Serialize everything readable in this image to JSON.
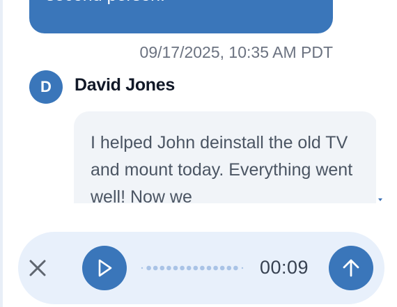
{
  "messages": {
    "outgoing": {
      "text": "second person."
    },
    "incoming": {
      "timestamp": "09/17/2025, 10:35 AM PDT",
      "avatar_initial": "D",
      "sender_name": "David Jones",
      "text": "I helped John deinstall the old TV and mount today. Everything went well! Now we"
    }
  },
  "composer": {
    "cancel_icon": "close-icon",
    "play_icon": "play-icon",
    "waveform_icon": "waveform-dots",
    "duration": "00:09",
    "send_icon": "arrow-up-icon"
  },
  "colors": {
    "accent": "#3a76ba",
    "incoming_bubble": "#f1f4f8",
    "composer_bg": "#e8f0fb",
    "waveform_dot": "#a9c3e6"
  }
}
